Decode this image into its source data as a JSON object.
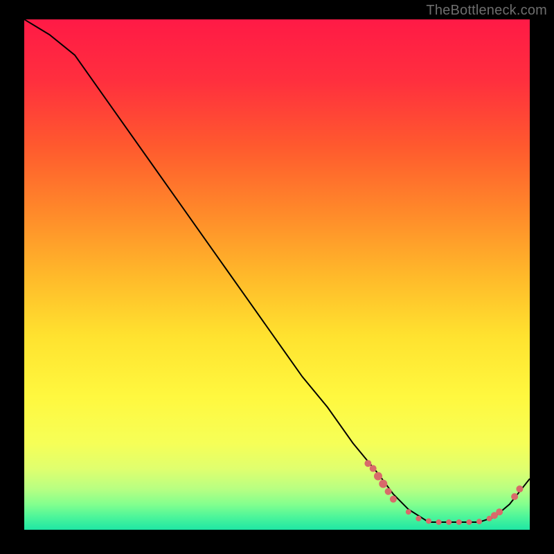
{
  "watermark": "TheBottleneck.com",
  "chart_data": {
    "type": "line",
    "title": "",
    "xlabel": "",
    "ylabel": "",
    "xlim": [
      0,
      100
    ],
    "ylim": [
      0,
      100
    ],
    "grid": false,
    "legend": false,
    "series": [
      {
        "name": "curve",
        "x": [
          0,
          5,
          10,
          15,
          20,
          25,
          30,
          35,
          40,
          45,
          50,
          55,
          60,
          65,
          70,
          73,
          76,
          80,
          85,
          90,
          93,
          96,
          100
        ],
        "y": [
          100,
          97,
          93,
          86,
          79,
          72,
          65,
          58,
          51,
          44,
          37,
          30,
          24,
          17,
          11,
          7,
          4,
          1.5,
          1.5,
          1.5,
          2.5,
          5,
          10
        ]
      }
    ],
    "markers": [
      {
        "x": 68,
        "y": 13,
        "size": 5
      },
      {
        "x": 69,
        "y": 12,
        "size": 5
      },
      {
        "x": 70,
        "y": 10.5,
        "size": 6
      },
      {
        "x": 71,
        "y": 9,
        "size": 6
      },
      {
        "x": 72,
        "y": 7.5,
        "size": 5
      },
      {
        "x": 73,
        "y": 6,
        "size": 5
      },
      {
        "x": 76,
        "y": 3.5,
        "size": 4
      },
      {
        "x": 78,
        "y": 2.2,
        "size": 4
      },
      {
        "x": 80,
        "y": 1.7,
        "size": 4
      },
      {
        "x": 82,
        "y": 1.5,
        "size": 4
      },
      {
        "x": 84,
        "y": 1.5,
        "size": 4
      },
      {
        "x": 86,
        "y": 1.5,
        "size": 4
      },
      {
        "x": 88,
        "y": 1.5,
        "size": 4
      },
      {
        "x": 90,
        "y": 1.6,
        "size": 4
      },
      {
        "x": 92,
        "y": 2.2,
        "size": 4
      },
      {
        "x": 93,
        "y": 2.8,
        "size": 5
      },
      {
        "x": 94,
        "y": 3.5,
        "size": 5
      },
      {
        "x": 97,
        "y": 6.5,
        "size": 5
      },
      {
        "x": 98,
        "y": 8,
        "size": 5
      }
    ],
    "gradient_stops": [
      {
        "offset": 0.0,
        "color": "#ff1a46"
      },
      {
        "offset": 0.12,
        "color": "#ff2f3e"
      },
      {
        "offset": 0.25,
        "color": "#ff5a2e"
      },
      {
        "offset": 0.38,
        "color": "#ff8a2a"
      },
      {
        "offset": 0.5,
        "color": "#ffb82a"
      },
      {
        "offset": 0.62,
        "color": "#ffe22f"
      },
      {
        "offset": 0.74,
        "color": "#fff83f"
      },
      {
        "offset": 0.83,
        "color": "#f6ff57"
      },
      {
        "offset": 0.88,
        "color": "#e0ff6e"
      },
      {
        "offset": 0.92,
        "color": "#b8ff82"
      },
      {
        "offset": 0.95,
        "color": "#83ff8e"
      },
      {
        "offset": 0.975,
        "color": "#4cf59a"
      },
      {
        "offset": 1.0,
        "color": "#1fe6a4"
      }
    ],
    "marker_color": "#d86a6a",
    "line_color": "#000000"
  }
}
